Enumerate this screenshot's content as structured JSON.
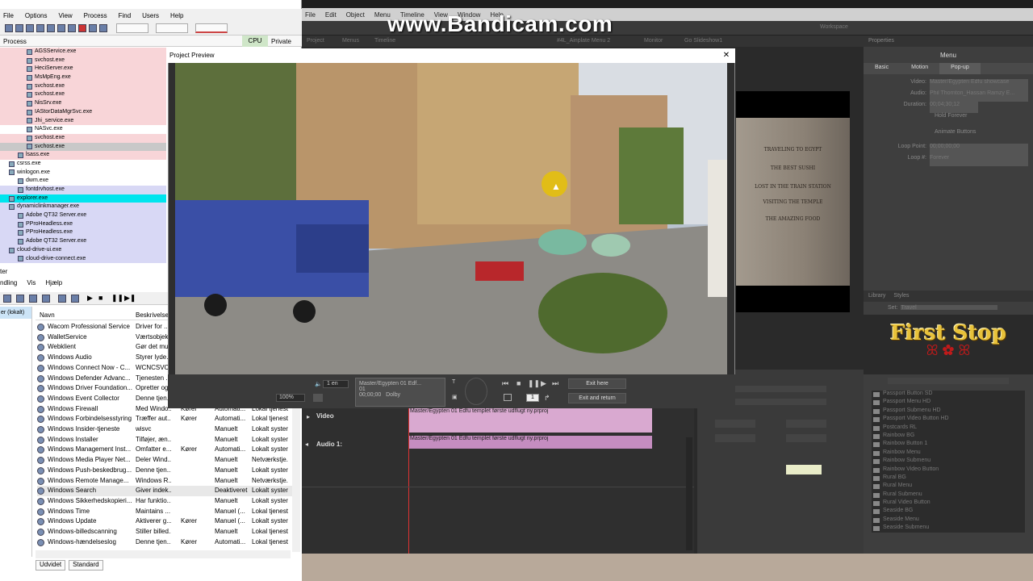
{
  "process_explorer": {
    "menu": [
      "File",
      "Options",
      "View",
      "Process",
      "Find",
      "Users",
      "Help"
    ],
    "columns": {
      "process": "Process",
      "cpu": "CPU",
      "private": "Private"
    },
    "rows": [
      {
        "name": "AGSService.exe",
        "color": "pink",
        "indent": 3
      },
      {
        "name": "svchost.exe",
        "color": "pink",
        "indent": 3
      },
      {
        "name": "HeciServer.exe",
        "color": "pink",
        "indent": 3
      },
      {
        "name": "MsMpEng.exe",
        "color": "pink",
        "indent": 3
      },
      {
        "name": "svchost.exe",
        "color": "pink",
        "indent": 3
      },
      {
        "name": "svchost.exe",
        "color": "pink",
        "indent": 3
      },
      {
        "name": "NisSrv.exe",
        "color": "pink",
        "indent": 3
      },
      {
        "name": "IAStorDataMgrSvc.exe",
        "color": "pink",
        "indent": 3
      },
      {
        "name": "Jhi_service.exe",
        "color": "pink",
        "indent": 3
      },
      {
        "name": "NASvc.exe",
        "color": "white",
        "indent": 3
      },
      {
        "name": "svchost.exe",
        "color": "pink",
        "indent": 3
      },
      {
        "name": "svchost.exe",
        "color": "gray",
        "indent": 3
      },
      {
        "name": "lsass.exe",
        "color": "pink",
        "indent": 2
      },
      {
        "name": "csrss.exe",
        "color": "white",
        "indent": 1
      },
      {
        "name": "winlogon.exe",
        "color": "white",
        "indent": 1
      },
      {
        "name": "dwm.exe",
        "color": "white",
        "indent": 2
      },
      {
        "name": "fontdrvhost.exe",
        "color": "lav",
        "indent": 2
      },
      {
        "name": "explorer.exe",
        "color": "cyan",
        "indent": 1
      },
      {
        "name": "dynamiclinkmanager.exe",
        "color": "lav",
        "indent": 1
      },
      {
        "name": "Adobe QT32 Server.exe",
        "color": "lav",
        "indent": 2
      },
      {
        "name": "PProHeadless.exe",
        "color": "lav",
        "indent": 2
      },
      {
        "name": "PProHeadless.exe",
        "color": "lav",
        "indent": 2
      },
      {
        "name": "Adobe QT32 Server.exe",
        "color": "lav",
        "indent": 2
      },
      {
        "name": "cloud-drive-ui.exe",
        "color": "lav",
        "indent": 1
      },
      {
        "name": "cloud-drive-connect.exe",
        "color": "lav",
        "indent": 2
      }
    ]
  },
  "services": {
    "title_fragment": "ter",
    "menu": [
      "ndling",
      "Vis",
      "Hjælp"
    ],
    "left_item": "er (lokalt)",
    "columns": {
      "name": "Navn",
      "desc": "Beskrivelse",
      "status": "",
      "type": "",
      "logon": ""
    },
    "rows": [
      {
        "name": "Wacom Professional Service",
        "desc": "Driver for ...",
        "status": "",
        "type": "",
        "logon": ""
      },
      {
        "name": "WalletService",
        "desc": "Værtsobjek...",
        "status": "",
        "type": "",
        "logon": ""
      },
      {
        "name": "Webklient",
        "desc": "Gør det mu...",
        "status": "",
        "type": "",
        "logon": ""
      },
      {
        "name": "Windows Audio",
        "desc": "Styrer lyde...",
        "status": "",
        "type": "",
        "logon": ""
      },
      {
        "name": "Windows Connect Now - C...",
        "desc": "WCNCSVC ...",
        "status": "",
        "type": "",
        "logon": ""
      },
      {
        "name": "Windows Defender Advanc...",
        "desc": "Tjenesten ...",
        "status": "",
        "type": "",
        "logon": ""
      },
      {
        "name": "Windows Driver Foundation...",
        "desc": "Opretter og...",
        "status": "",
        "type": "",
        "logon": ""
      },
      {
        "name": "Windows Event Collector",
        "desc": "Denne tjen...",
        "status": "",
        "type": "",
        "logon": ""
      },
      {
        "name": "Windows Firewall",
        "desc": "Med Windo...",
        "status": "Kører",
        "type": "Automati...",
        "logon": "Lokal tjenest"
      },
      {
        "name": "Windows Forbindelsesstyring",
        "desc": "Træffer aut...",
        "status": "Kører",
        "type": "Automati...",
        "logon": "Lokal tjenest"
      },
      {
        "name": "Windows Insider-tjeneste",
        "desc": "wisvc",
        "status": "",
        "type": "Manuelt",
        "logon": "Lokalt syster"
      },
      {
        "name": "Windows Installer",
        "desc": "Tilføjer, æn...",
        "status": "",
        "type": "Manuelt",
        "logon": "Lokalt syster"
      },
      {
        "name": "Windows Management Inst...",
        "desc": "Omfatter e...",
        "status": "Kører",
        "type": "Automati...",
        "logon": "Lokalt syster"
      },
      {
        "name": "Windows Media Player Net...",
        "desc": "Deler Wind...",
        "status": "",
        "type": "Manuelt",
        "logon": "Netværkstje."
      },
      {
        "name": "Windows Push-beskedbrug...",
        "desc": "Denne tjen...",
        "status": "",
        "type": "Manuelt",
        "logon": "Lokalt syster"
      },
      {
        "name": "Windows Remote Manage...",
        "desc": "Windows R...",
        "status": "",
        "type": "Manuelt",
        "logon": "Netværkstje."
      },
      {
        "name": "Windows Search",
        "desc": "Giver indek...",
        "status": "",
        "type": "Deaktiveret",
        "logon": "Lokalt syster"
      },
      {
        "name": "Windows Sikkerhedskopieri...",
        "desc": "Har funktio...",
        "status": "",
        "type": "Manuelt",
        "logon": "Lokalt syster"
      },
      {
        "name": "Windows Time",
        "desc": "Maintains ...",
        "status": "",
        "type": "Manuel (...",
        "logon": "Lokal tjenest"
      },
      {
        "name": "Windows Update",
        "desc": "Aktiverer g...",
        "status": "Kører",
        "type": "Manuel (...",
        "logon": "Lokalt syster"
      },
      {
        "name": "Windows-billedscanning",
        "desc": "Stiller billed...",
        "status": "",
        "type": "Manuelt",
        "logon": "Lokal tjenest"
      },
      {
        "name": "Windows-hændelseslog",
        "desc": "Denne tjen...",
        "status": "Kører",
        "type": "Automati...",
        "logon": "Lokal tjenest"
      }
    ],
    "tabs": [
      "Udvidet",
      "Standard"
    ]
  },
  "encore": {
    "menu": [
      "File",
      "Edit",
      "Object",
      "Menu",
      "Timeline",
      "View",
      "Window",
      "Help"
    ],
    "tabs": [
      "Project",
      "Menus",
      "Timeline",
      "#4L_Ainplate Menu 2",
      "Monitor",
      "Go Slideshow1"
    ],
    "workspace": "Workspace",
    "properties": {
      "tab": "Properties",
      "heading": "Menu",
      "subtabs": [
        "Basic",
        "Motion",
        "Pop-up"
      ],
      "fields": [
        {
          "label": "Video:",
          "value": "Master/Egypten Edfu showcase"
        },
        {
          "label": "Audio:",
          "value": "Phil Thornton_Hassan Ramzy E..."
        },
        {
          "label": "Duration:",
          "value": "00;04;30;12"
        }
      ],
      "checks": [
        "Hold Forever",
        "Animate Buttons"
      ],
      "loop_point_label": "Loop Point:",
      "loop_point": "00;00;00;00",
      "loop_label": "Loop #:",
      "loop_value": "Forever"
    },
    "library": {
      "tabs": [
        "Library",
        "Styles"
      ],
      "set_label": "Set:",
      "set_value": "Travel",
      "items": [
        "Passport Button SD",
        "Passport Menu HD",
        "Passport Submenu HD",
        "Passport Video Button HD",
        "Postcards RL",
        "Rainbow BG",
        "Rainbow Button 1",
        "Rainbow Menu",
        "Rainbow Submenu",
        "Rainbow Video Button",
        "Rural BG",
        "Rural Menu",
        "Rural Submenu",
        "Rural Video Button",
        "Seaside BG",
        "Seaside Menu",
        "Seaside Submenu"
      ]
    },
    "menu_preview": {
      "title": "First Stop",
      "items": [
        "TRAVELING TO EGYPT",
        "THE BEST SUSHI",
        "LOST IN THE TRAIN STATION",
        "VISITING THE TEMPLE",
        "THE AMAZING FOOD"
      ]
    },
    "timeline": {
      "video_label": "Video",
      "audio_label": "Audio 1:",
      "clip": "Master/Egypten 01 Edfu templet første udflugt ny.prproj"
    }
  },
  "watermark": "www.Bandicam.com",
  "preview": {
    "title": "Project Preview",
    "lang": "1 en",
    "zoom": "100%",
    "source_name": "Master/Egypten 01 Edf...",
    "chapter": "01",
    "timecode": "00;00;00",
    "audio": "Dolby",
    "counter": "1",
    "exit_here": "Exit here",
    "exit_return": "Exit and return"
  }
}
